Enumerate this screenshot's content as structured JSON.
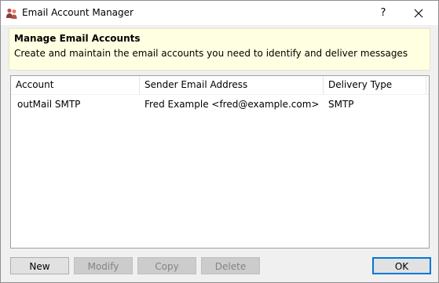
{
  "window": {
    "title": "Email Account Manager",
    "help_label": "?"
  },
  "banner": {
    "title": "Manage Email Accounts",
    "description": "Create and maintain the email accounts you need to identify and deliver messages"
  },
  "table": {
    "columns": [
      "Account",
      "Sender Email Address",
      "Delivery Type"
    ],
    "rows": [
      {
        "account": "outMail SMTP",
        "sender": "Fred Example <fred@example.com>",
        "delivery": "SMTP"
      }
    ]
  },
  "buttons": {
    "new": "New",
    "modify": "Modify",
    "copy": "Copy",
    "delete": "Delete",
    "ok": "OK"
  },
  "colors": {
    "banner_bg": "#ffffe1",
    "focus_border": "#0078d7"
  }
}
